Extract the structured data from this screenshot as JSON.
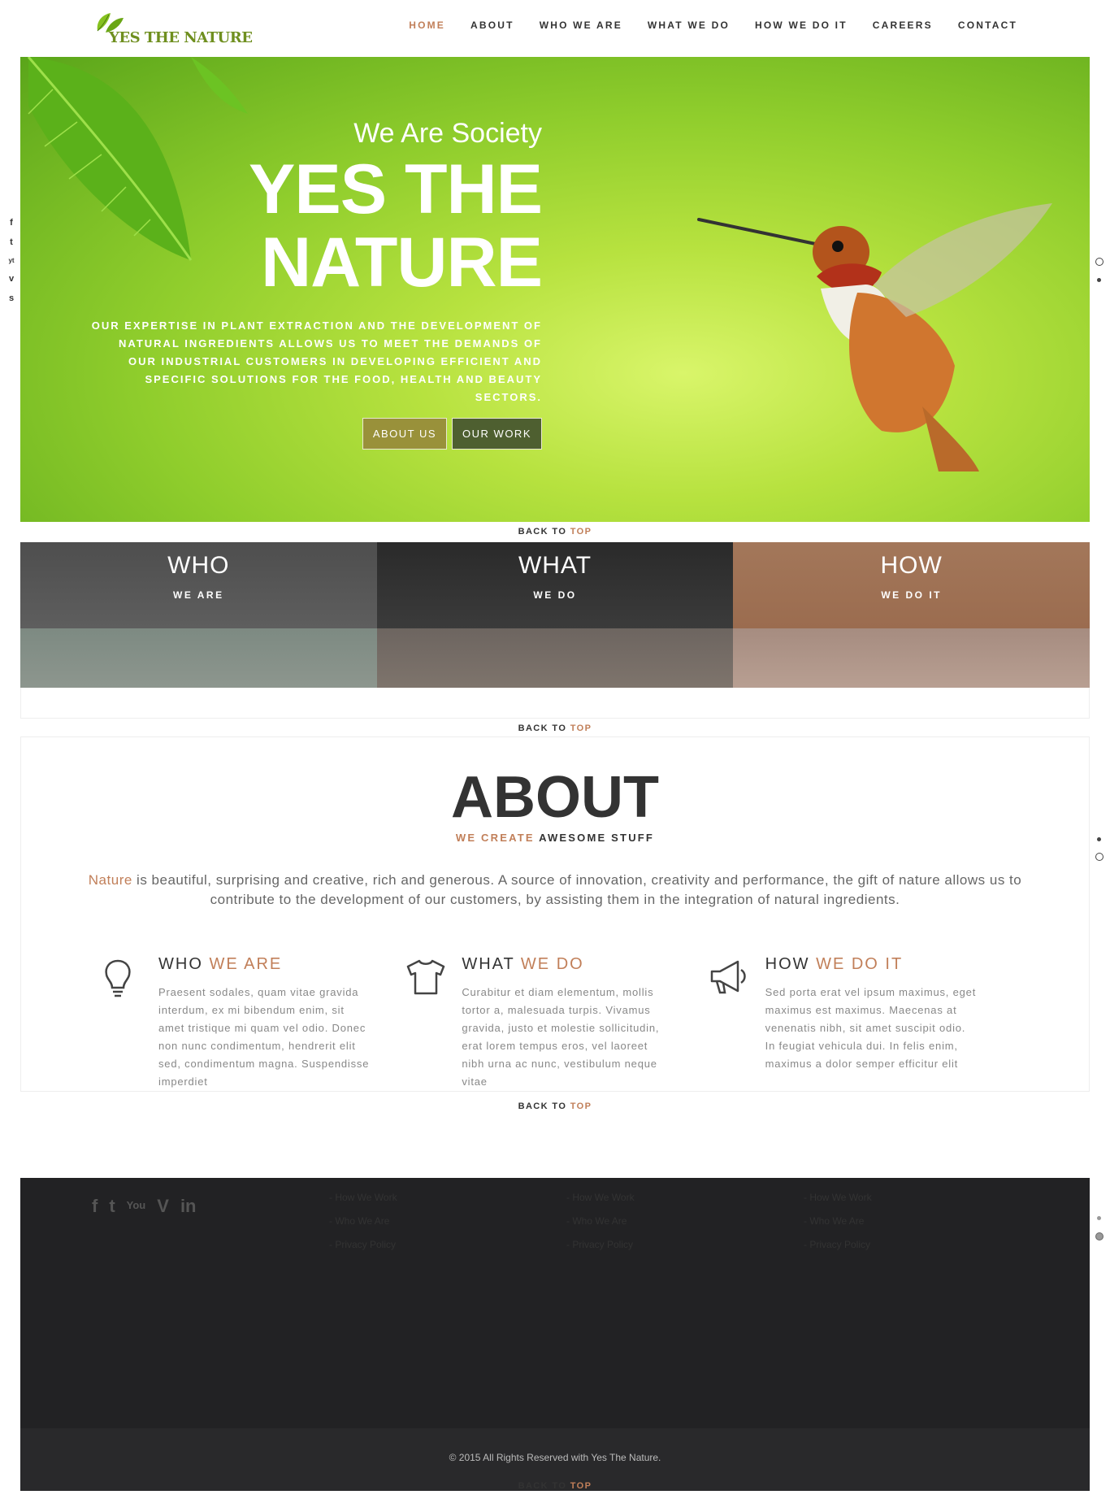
{
  "brand": {
    "name": "YES THE NATURE",
    "accent": "#c17f59"
  },
  "nav": [
    {
      "label": "HOME",
      "active": true
    },
    {
      "label": "ABOUT"
    },
    {
      "label": "WHO WE ARE"
    },
    {
      "label": "WHAT WE DO"
    },
    {
      "label": "HOW WE DO IT"
    },
    {
      "label": "CAREERS"
    },
    {
      "label": "CONTACT"
    }
  ],
  "hero": {
    "small": "We Are Society",
    "big1": "YES THE",
    "big2": "NATURE",
    "desc": "OUR EXPERTISE IN PLANT EXTRACTION AND THE DEVELOPMENT OF NATURAL INGREDIENTS ALLOWS US TO MEET THE DEMANDS OF OUR INDUSTRIAL CUSTOMERS IN DEVELOPING EFFICIENT AND SPECIFIC SOLUTIONS FOR THE FOOD, HEALTH AND BEAUTY SECTORS.",
    "btn_about": "ABOUT US",
    "btn_work": "OUR WORK"
  },
  "social_side": [
    "f",
    "t",
    "yt",
    "v",
    "s"
  ],
  "back_to_top": {
    "back": "BACK TO ",
    "top": "TOP"
  },
  "panels": [
    {
      "title": "WHO",
      "sub": "WE ARE"
    },
    {
      "title": "WHAT",
      "sub": "WE DO"
    },
    {
      "title": "HOW",
      "sub": "WE DO IT"
    }
  ],
  "about": {
    "title": "ABOUT",
    "sub_accent": "WE CREATE",
    "sub_rest": " AWESOME STUFF",
    "intro_accent": "Nature",
    "intro_rest": " is beautiful, surprising and creative, rich and generous. A source of innovation, creativity and performance, the gift of nature allows us to contribute to the development of our customers, by assisting them in the integration of natural ingredients.",
    "cols": [
      {
        "icon": "lightbulb-icon",
        "h1": "WHO ",
        "h2": "WE ARE",
        "text": "Praesent sodales, quam vitae gravida interdum, ex mi bibendum enim, sit amet tristique mi quam vel odio. Donec non nunc condimentum, hendrerit elit sed, condimentum magna. Suspendisse imperdiet"
      },
      {
        "icon": "tshirt-icon",
        "h1": "WHAT ",
        "h2": "WE DO",
        "text": "Curabitur et diam elementum, mollis tortor a, malesuada turpis. Vivamus gravida, justo et molestie sollicitudin, erat lorem tempus eros, vel laoreet nibh urna ac nunc, vestibulum neque vitae"
      },
      {
        "icon": "megaphone-icon",
        "h1": "HOW ",
        "h2": "WE DO IT",
        "text": "Sed porta erat vel ipsum maximus, eget maximus est maximus. Maecenas at venenatis nibh, sit amet suscipit odio. In feugiat vehicula dui. In felis enim, maximus a dolor semper efficitur elit"
      }
    ]
  },
  "footer": {
    "social": [
      "f",
      "t",
      "You",
      "V",
      "in"
    ],
    "links": [
      "- How We Work",
      "- Who We Are",
      "- Privacy Policy"
    ],
    "copyright": "© 2015 All Rights Reserved with Yes The Nature."
  }
}
